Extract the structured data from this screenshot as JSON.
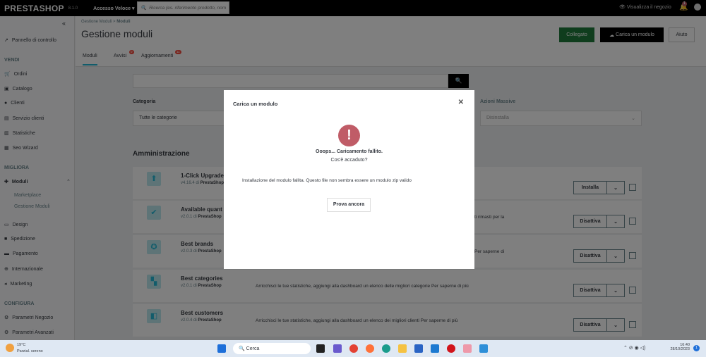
{
  "topbar": {
    "logo": "PRESTASHOP",
    "version": "8.1.0",
    "quick_access": "Accesso Veloce ▾",
    "search_placeholder": "Ricerca (es. riferimento prodotto, nom",
    "view_shop": "Visualizza il negozio",
    "notif_count": "1"
  },
  "sidebar": {
    "collapse": "«",
    "dashboard": "Pannello di controllo",
    "sections": [
      "VENDI",
      "MIGLIORA",
      "CONFIGURA"
    ],
    "sell": [
      "Ordini",
      "Catalogo",
      "Clienti",
      "Servizio clienti",
      "Statistiche",
      "Seo Wizard"
    ],
    "modules": "Moduli",
    "module_sub": [
      "Marketplace",
      "Gestione Moduli"
    ],
    "improve": [
      "Design",
      "Spedizione",
      "Pagamento",
      "Internazionale",
      "Marketing"
    ],
    "configure": [
      "Parametri Negozio",
      "Parametri Avanzati"
    ]
  },
  "header": {
    "breadcrumb_parent": "Gestione Moduli",
    "breadcrumb_sep": ">",
    "breadcrumb_current": "Moduli",
    "title": "Gestione moduli",
    "connected": "Collegato",
    "upload": "Carica un modulo",
    "help": "Aiuto",
    "tabs": [
      {
        "label": "Moduli"
      },
      {
        "label": "Avvisi",
        "badge": "0"
      },
      {
        "label": "Aggiornamenti",
        "badge": "11"
      }
    ]
  },
  "filters": {
    "category_label": "Categoria",
    "category_value": "Tutte le categorie",
    "bulk_label": "Azioni Massive",
    "bulk_value": "Disinstalla"
  },
  "section_title": "Amministrazione",
  "modules": [
    {
      "name": "1-Click Upgrade",
      "version": "v4.16.4",
      "by": "di",
      "author": "PrestaShop",
      "desc": "",
      "action": "Installa"
    },
    {
      "name": "Available quant",
      "version": "v2.0.1",
      "by": "di",
      "author": "PrestaShop",
      "desc": "ti rimasti per la",
      "action": "Disattiva"
    },
    {
      "name": "Best brands",
      "version": "v2.0.3",
      "by": "di",
      "author": "PrestaShop",
      "desc": "Per saperne di",
      "action": "Disattiva"
    },
    {
      "name": "Best categories",
      "version": "v2.0.1",
      "by": "di",
      "author": "PrestaShop",
      "desc": "Arricchisci le tue statistiche, aggiungi alla dashboard un elenco delle migliori categorie Per saperne di più",
      "action": "Disattiva"
    },
    {
      "name": "Best customers",
      "version": "v2.0.4",
      "by": "di",
      "author": "PrestaShop",
      "desc": "Arricchisci le tue statistiche, aggiungi alla dashboard un elenco dei migliori clienti Per saperne di più",
      "action": "Disattiva"
    }
  ],
  "modal": {
    "title": "Carica un modulo",
    "close": "✕",
    "heading": "Ooops... Caricamento fallito.",
    "sub": "Cos'è accaduto?",
    "message": "Installazione del modulo fallita. Questo file non sembra essere un modulo zip valido",
    "retry": "Prova ancora"
  },
  "taskbar": {
    "weather_temp": "19°C",
    "weather_desc": "Parzial. sereno",
    "search": "Cerca",
    "time": "16:40",
    "date": "28/10/2023",
    "notif": "1"
  },
  "colors": {
    "error": "#c05c67",
    "connected": "#1f7a3a"
  }
}
